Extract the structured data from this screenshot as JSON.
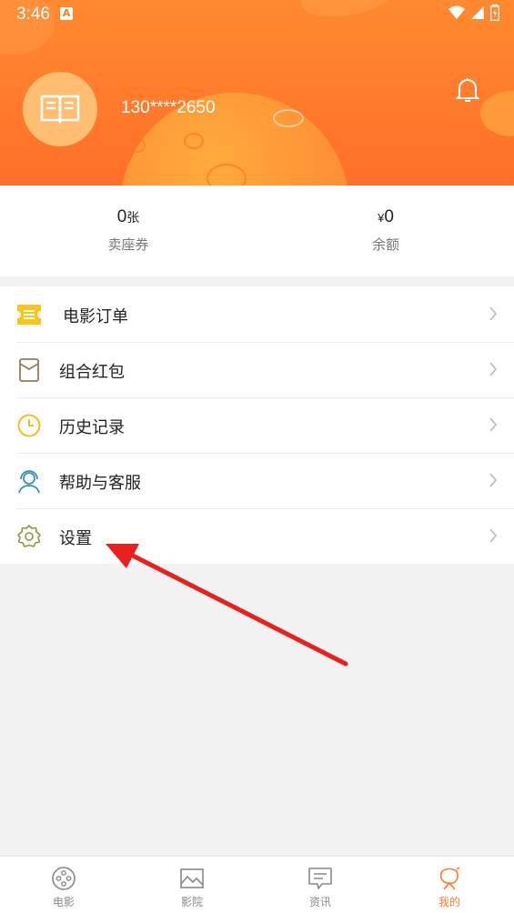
{
  "status_bar": {
    "time": "3:46",
    "notification_badge": "A"
  },
  "profile": {
    "phone": "130****2650",
    "avatar_icon": "book-icon",
    "bell_icon": "bell-icon"
  },
  "stats": [
    {
      "value": "0",
      "unit": "张",
      "label": "卖座券"
    },
    {
      "currency": "¥",
      "value": "0",
      "label": "余额"
    }
  ],
  "menu": [
    {
      "label": "电影订单",
      "icon": "ticket-icon",
      "color": "#ffc31e"
    },
    {
      "label": "组合红包",
      "icon": "red-envelope-icon",
      "color": "#9a7a5a"
    },
    {
      "label": "历史记录",
      "icon": "clock-icon",
      "color": "#f2c01e"
    },
    {
      "label": "帮助与客服",
      "icon": "headset-icon",
      "color": "#3d8fb8"
    },
    {
      "label": "设置",
      "icon": "gear-icon",
      "color": "#8a9a3a"
    }
  ],
  "bottom_nav": [
    {
      "label": "电影",
      "icon": "film-reel-icon",
      "active": false
    },
    {
      "label": "影院",
      "icon": "landscape-icon",
      "active": false
    },
    {
      "label": "资讯",
      "icon": "message-icon",
      "active": false
    },
    {
      "label": "我的",
      "icon": "profile-icon",
      "active": true
    }
  ],
  "colors": {
    "accent": "#ff7a2c",
    "annotation_arrow": "#e8201e"
  }
}
